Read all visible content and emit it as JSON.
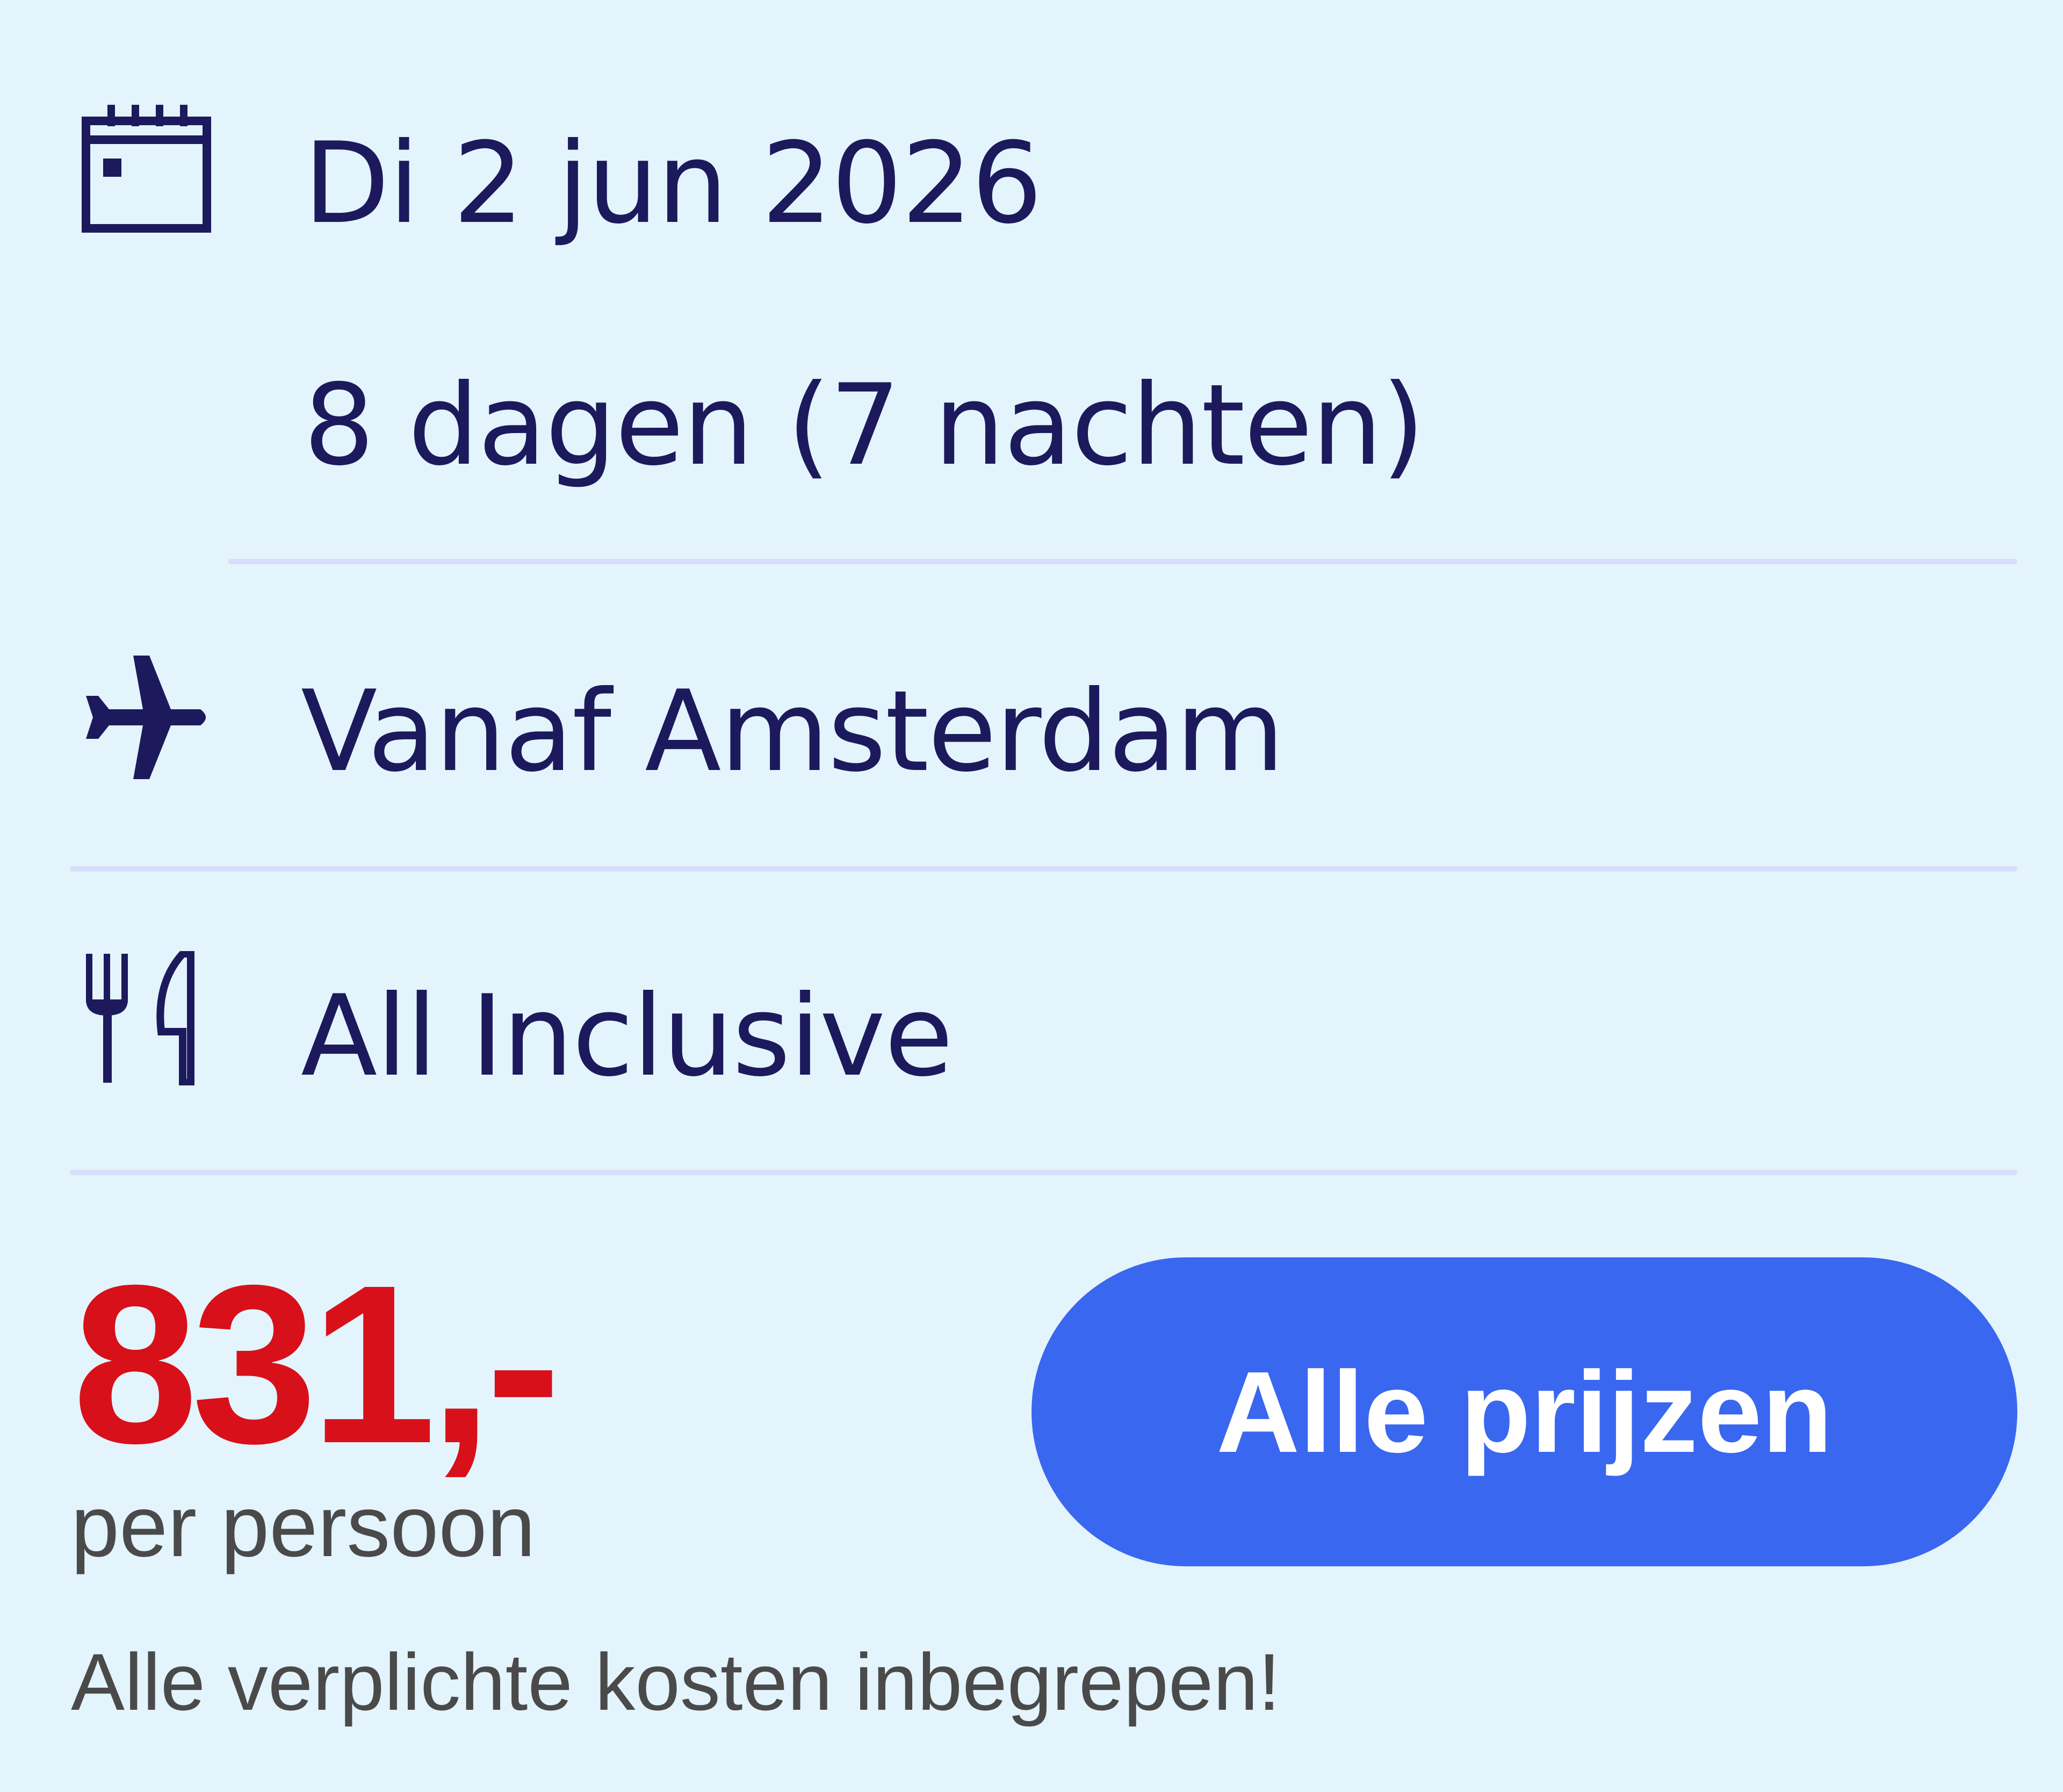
{
  "trip": {
    "date": "Di 2 jun 2026",
    "duration": "8 dagen (7 nachten)",
    "departure": "Vanaf Amsterdam",
    "board": "All Inclusive"
  },
  "pricing": {
    "price": "831,-",
    "per_person": "per persoon",
    "note": "Alle verplichte kosten inbegrepen!"
  },
  "actions": {
    "all_prices_label": "Alle prijzen"
  },
  "icons": {
    "date": "calendar-icon",
    "departure": "airplane-icon",
    "board": "fork-knife-icon"
  },
  "colors": {
    "background": "#e3f4fc",
    "text": "#1c1a5c",
    "price": "#d8101a",
    "button": "#3a67ef",
    "divider": "#d9dcfb",
    "secondary_text": "#4a4a4a"
  }
}
